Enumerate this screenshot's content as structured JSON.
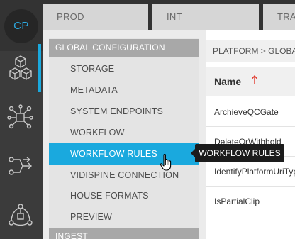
{
  "rail": {
    "logo_text": "CP",
    "icons": [
      "cubes-icon",
      "workflow-network-icon",
      "route-arrows-icon",
      "cycle-network-icon"
    ],
    "accent": "#1aa9de"
  },
  "env_tabs": [
    {
      "label": "PROD"
    },
    {
      "label": "INT"
    },
    {
      "label": "TRAN"
    }
  ],
  "menu": {
    "sections": [
      {
        "header": "GLOBAL CONFIGURATION",
        "items": [
          "STORAGE",
          "METADATA",
          "SYSTEM ENDPOINTS",
          "WORKFLOW",
          "WORKFLOW RULES",
          "VIDISPINE CONNECTION",
          "HOUSE FORMATS",
          "PREVIEW"
        ]
      },
      {
        "header": "INGEST"
      }
    ],
    "active_item": "WORKFLOW RULES"
  },
  "tooltip": {
    "text": "WORKFLOW RULES"
  },
  "main": {
    "breadcrumb": "PLATFORM > GLOBAL",
    "table": {
      "column_header": "Name",
      "sort": "ascending",
      "rows": [
        "ArchieveQCGate",
        "DeleteOrWithhold",
        "IdentifyPlatformUriType",
        "IsPartialClip"
      ]
    }
  },
  "colors": {
    "accent": "#1aa9de",
    "sort_arrow": "#e23b2e",
    "rail": "#3b3b3b",
    "menu_header": "#a8a8a8"
  }
}
